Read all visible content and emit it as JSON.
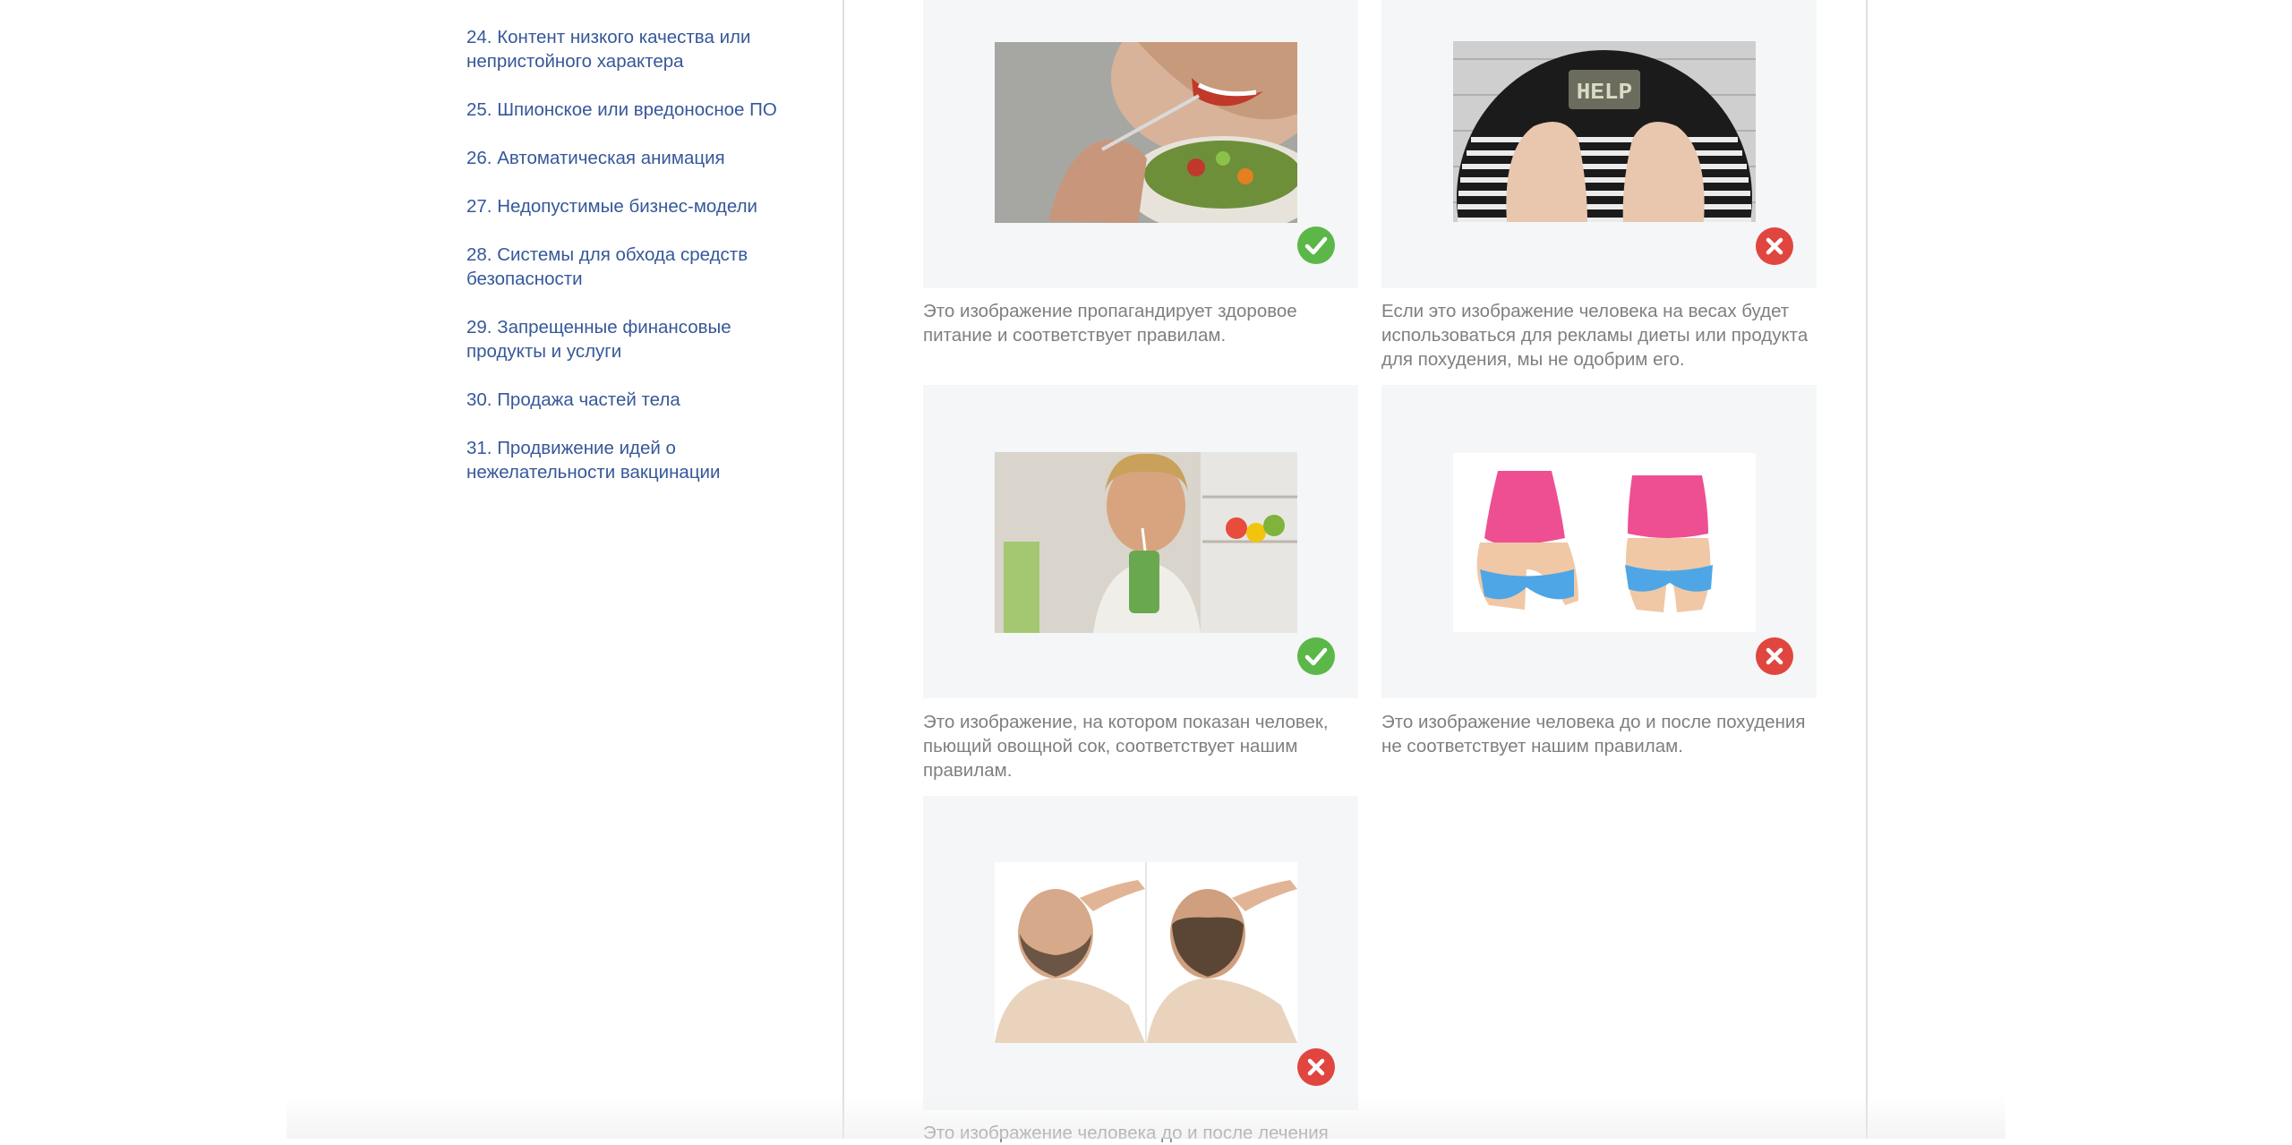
{
  "sidebar": {
    "items": [
      {
        "label": "24. Контент низкого качества или непристойного характера"
      },
      {
        "label": "25. Шпионское или вредоносное ПО"
      },
      {
        "label": "26. Автоматическая анимация"
      },
      {
        "label": "27. Недопустимые бизнес-модели"
      },
      {
        "label": "28. Системы для обхода средств безопасности"
      },
      {
        "label": "29. Запрещенные финансовые продукты и услуги"
      },
      {
        "label": "30. Продажа частей тела"
      },
      {
        "label": "31. Продвижение идей о нежелательности вакцинации"
      }
    ]
  },
  "examples": [
    {
      "status": "approved",
      "icon": "check-icon",
      "image_alt": "woman eating salad",
      "caption": "Это изображение пропагандирует здоровое питание и соответствует правилам."
    },
    {
      "status": "rejected",
      "icon": "close-icon",
      "image_alt": "feet on scale with HELP display",
      "scale_display": "HELP",
      "caption": "Если это изображение человека на весах будет использоваться для рекламы диеты или продукта для похудения, мы не одобрим его."
    },
    {
      "status": "approved",
      "icon": "check-icon",
      "image_alt": "woman drinking vegetable juice",
      "caption": "Это изображение, на котором показан человек, пьющий овощной сок, соответствует нашим правилам."
    },
    {
      "status": "rejected",
      "icon": "close-icon",
      "image_alt": "before and after weight loss illustration",
      "caption": "Это изображение человека до и после похудения не соответствует нашим правилам."
    },
    {
      "status": "rejected",
      "icon": "close-icon",
      "image_alt": "man before and after hair loss treatment",
      "caption": "Это изображение человека до и после лечения"
    }
  ],
  "colors": {
    "link": "#365899",
    "caption": "#7f7f7f",
    "card_bg": "#f5f6f7",
    "approved": "#5cb749",
    "rejected": "#e0463f"
  }
}
